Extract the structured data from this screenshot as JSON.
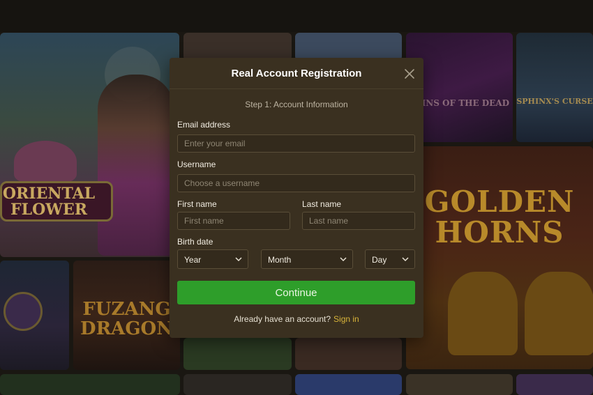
{
  "modal": {
    "title": "Real Account Registration",
    "step_text": "Step 1: Account Information",
    "email": {
      "label": "Email address",
      "placeholder": "Enter your email",
      "value": ""
    },
    "username": {
      "label": "Username",
      "placeholder": "Choose a username",
      "value": ""
    },
    "first_name": {
      "label": "First name",
      "placeholder": "First name",
      "value": ""
    },
    "last_name": {
      "label": "Last name",
      "placeholder": "Last name",
      "value": ""
    },
    "birth_date": {
      "label": "Birth date",
      "year": "Year",
      "month": "Month",
      "day": "Day"
    },
    "continue_label": "Continue",
    "signin_prompt": "Already have an account?",
    "signin_link": "Sign in"
  },
  "background_games": {
    "oriental_flower": "ORIENTAL FLOWER",
    "golden_horns": "GOLDEN HORNS",
    "fuzang_dragon": "FUZANG DRAGON",
    "spins_of_the_dead": "SPINS OF THE DEAD",
    "sphinxs_curse": "SPHINX'S CURSE"
  },
  "colors": {
    "accent_green": "#2e9e2a",
    "link_gold": "#d8b43a",
    "modal_bg": "#3a3020"
  }
}
